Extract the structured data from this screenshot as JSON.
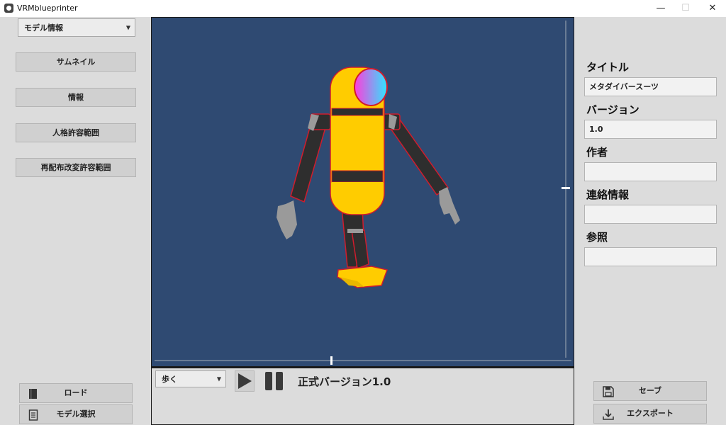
{
  "window": {
    "title": "VRMblueprinter",
    "minimize": "—",
    "maximize": "☐",
    "close": "✕"
  },
  "sidebar_left": {
    "model_dropdown": {
      "selected": "モデル情報",
      "arrow": "▼"
    },
    "nav_items": [
      {
        "label": "サムネイル"
      },
      {
        "label": "情報"
      },
      {
        "label": "人格許容範囲"
      },
      {
        "label": "再配布改変許容範囲"
      }
    ],
    "load_button": {
      "label": "ロード",
      "icon": "book-icon"
    },
    "model_select_button": {
      "label": "モデル選択",
      "icon": "document-icon"
    }
  },
  "viewport": {
    "background": "#2f4a72",
    "model": {
      "body_color": "#ffcc00",
      "limb_color": "#2e2e2e",
      "outline_color": "#d01c2c",
      "visor_gradient": [
        "#ff3cdc",
        "#2ee6ff"
      ]
    }
  },
  "animation_bar": {
    "animation_dropdown": {
      "selected": "歩く",
      "arrow": "▼"
    },
    "play_icon": "play-icon",
    "pause_icon": "pause-icon",
    "status_text": "正式バージョン1.0"
  },
  "sidebar_right": {
    "fields": [
      {
        "label": "タイトル",
        "value": "メタダイバースーツ"
      },
      {
        "label": "バージョン",
        "value": "1.0"
      },
      {
        "label": "作者",
        "value": ""
      },
      {
        "label": "連絡情報",
        "value": ""
      },
      {
        "label": "参照",
        "value": ""
      }
    ],
    "save_button": {
      "label": "セーブ",
      "icon": "floppy-disk-icon"
    },
    "export_button": {
      "label": "エクスポート",
      "icon": "download-icon"
    }
  }
}
